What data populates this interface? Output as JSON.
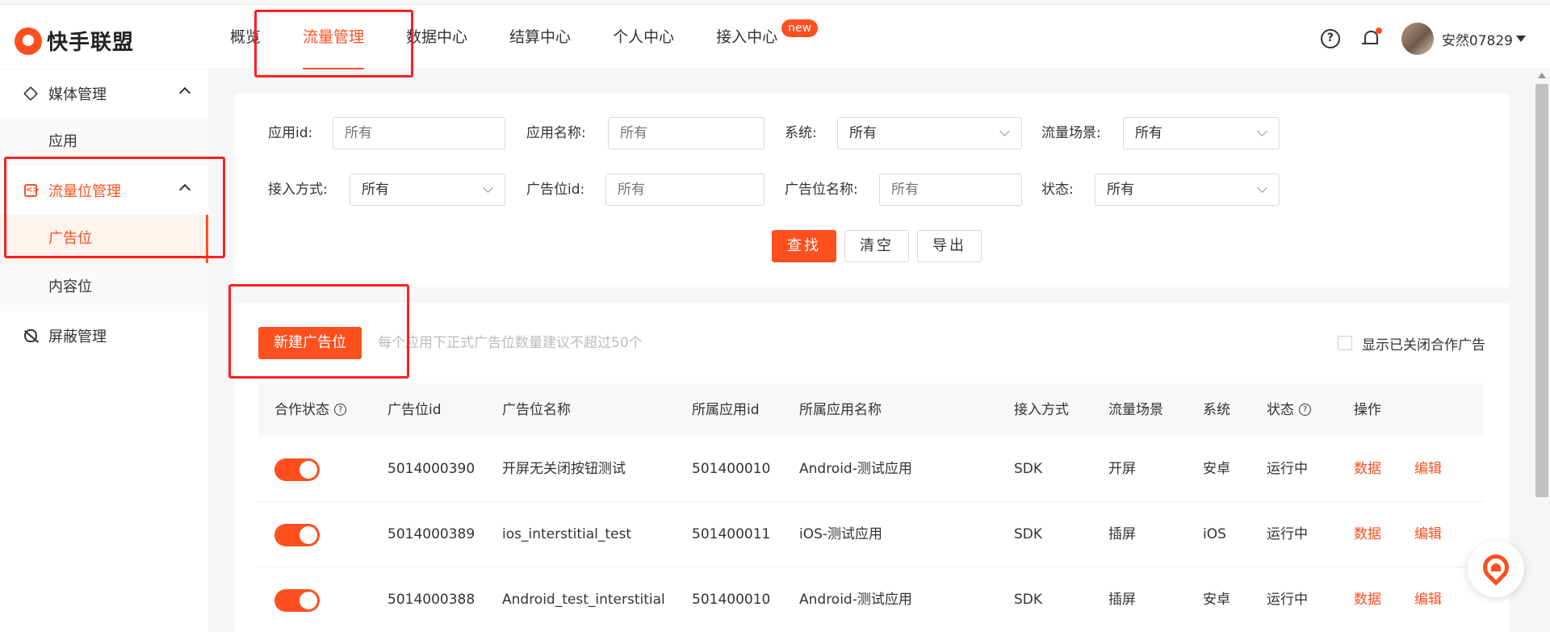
{
  "brand": {
    "name": "快手联盟"
  },
  "nav": {
    "items": [
      {
        "label": "概览"
      },
      {
        "label": "流量管理"
      },
      {
        "label": "数据中心"
      },
      {
        "label": "结算中心"
      },
      {
        "label": "个人中心"
      },
      {
        "label": "接入中心"
      }
    ],
    "new_badge": "new",
    "help_glyph": "?"
  },
  "user": {
    "name": "安然07829"
  },
  "sidebar": {
    "groups": [
      {
        "label": "媒体管理",
        "items": [
          "应用"
        ]
      },
      {
        "label": "流量位管理",
        "items": [
          "广告位",
          "内容位"
        ]
      },
      {
        "label": "屏蔽管理",
        "items": []
      }
    ],
    "code_glyph": "&lt;&gt;"
  },
  "filters": {
    "app_id": {
      "label": "应用id:",
      "placeholder": "所有"
    },
    "app_name": {
      "label": "应用名称:",
      "placeholder": "所有"
    },
    "system": {
      "label": "系统:",
      "value": "所有"
    },
    "scene": {
      "label": "流量场景:",
      "value": "所有"
    },
    "access": {
      "label": "接入方式:",
      "value": "所有"
    },
    "slot_id": {
      "label": "广告位id:",
      "placeholder": "所有"
    },
    "slot_name": {
      "label": "广告位名称:",
      "placeholder": "所有"
    },
    "status": {
      "label": "状态:",
      "value": "所有"
    },
    "search_btn": "查找",
    "clear_btn": "清空",
    "export_btn": "导出"
  },
  "list": {
    "new_btn": "新建广告位",
    "hint": "每个应用下正式广告位数量建议不超过50个",
    "show_closed": "显示已关闭合作广告",
    "help_glyph": "?",
    "columns": [
      "合作状态",
      "广告位id",
      "广告位名称",
      "所属应用id",
      "所属应用名称",
      "接入方式",
      "流量场景",
      "系统",
      "状态",
      "操作"
    ],
    "rows": [
      {
        "id": "5014000390",
        "name": "开屏无关闭按钮测试",
        "app_id": "501400010",
        "app_name": "Android-测试应用",
        "access": "SDK",
        "scene": "开屏",
        "system": "安卓",
        "status": "运行中",
        "action_data": "数据",
        "action_edit": "编辑"
      },
      {
        "id": "5014000389",
        "name": "ios_interstitial_test",
        "app_id": "501400011",
        "app_name": "iOS-测试应用",
        "access": "SDK",
        "scene": "插屏",
        "system": "iOS",
        "status": "运行中",
        "action_data": "数据",
        "action_edit": "编辑"
      },
      {
        "id": "5014000388",
        "name": "Android_test_interstitial",
        "app_id": "501400010",
        "app_name": "Android-测试应用",
        "access": "SDK",
        "scene": "插屏",
        "system": "安卓",
        "status": "运行中",
        "action_data": "数据",
        "action_edit": "编辑"
      }
    ]
  },
  "colors": {
    "accent": "#fe4f1e",
    "annotation": "#ff1f1f"
  }
}
